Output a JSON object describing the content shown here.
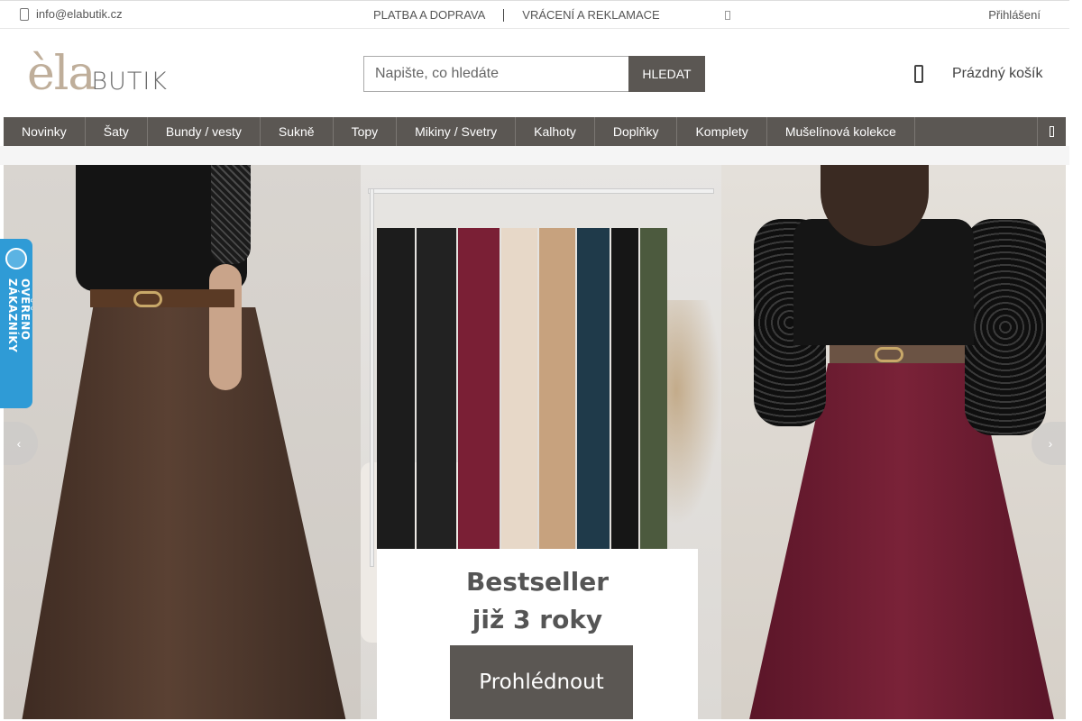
{
  "topbar": {
    "email": "info@elabutik.cz",
    "email_icon": "phone-icon",
    "links": [
      "PLATBA A DOPRAVA",
      "VRÁCENÍ A REKLAMACE"
    ],
    "login": "Přihlášení"
  },
  "header": {
    "logo_main": "èla",
    "logo_sub": "BUTIK",
    "search_placeholder": "Napište, co hledáte",
    "search_value": "",
    "search_button": "HLEDAT",
    "cart_icon": "shopping-bag-icon",
    "cart_label": "Prázdný košík"
  },
  "nav": {
    "items": [
      "Novinky",
      "Šaty",
      "Bundy / vesty",
      "Sukně",
      "Topy",
      "Mikiny / Svetry",
      "Kalhoty",
      "Doplňky",
      "Komplety",
      "Mušelínová kolekce"
    ],
    "more_icon": "menu-more-icon"
  },
  "hero": {
    "promo_line1": "Bestseller",
    "promo_line2": "již 3 roky",
    "cta": "Prohlédnout",
    "prev_icon": "chevron-left-icon",
    "next_icon": "chevron-right-icon"
  },
  "badge": {
    "text": "OVĚŘENO ZÁKAZNÍKY",
    "icon": "verified-seal-icon"
  },
  "colors": {
    "nav_bg": "#5b5753",
    "logo_gold": "#bfae9a",
    "badge_blue": "#2f9bd6"
  }
}
